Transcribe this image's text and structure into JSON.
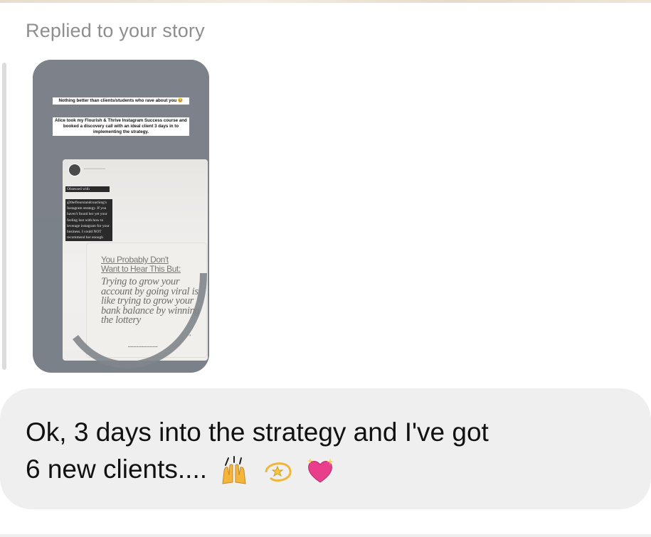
{
  "reply_label": "Replied to your story",
  "story": {
    "caption_line1": "Nothing better than clients/students who rave about you 🥹",
    "caption_line2": "Alice took my Flourish & Thrive Instagram Success course and booked a discovery call with an ideal client 3 days in to implementing the strategy.",
    "dark_label": "Obsessed with",
    "dark_block": "@thefloursiandcoaching's Instagram strategy. If you haven't found her yet your feeling lost with how to leverage instagram for your business. I could NOT recommend her enough",
    "post_headline": "You Probably Don't Want to Hear This But:",
    "post_body": "Trying to grow your account by going viral is like trying to grow your bank balance by winning the lottery",
    "post_arrow": "→"
  },
  "message": {
    "line1": "Ok, 3 days into the strategy and I've got",
    "line2": "6 new clients....",
    "emojis": [
      "raising-hands-icon",
      "dizzy-icon",
      "sparkling-heart-icon"
    ]
  },
  "colors": {
    "bubble": "#efefef",
    "story_bg": "#7b8188",
    "label_gray": "#8e8e8e"
  }
}
